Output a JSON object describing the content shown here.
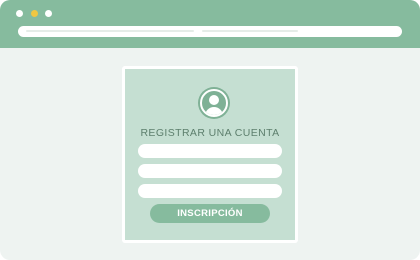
{
  "colors": {
    "titlebar": "#86bb9e",
    "window_background": "#eef3f1",
    "card_background": "#c5dfd2",
    "accent": "#86bb9e",
    "title_text": "#5d7f6d",
    "minimize_dot": "#f0c742"
  },
  "window": {
    "controls": [
      "close-dot",
      "minimize-dot",
      "maximize-dot"
    ]
  },
  "address_bar": {
    "value": ""
  },
  "form": {
    "avatar_icon": "user-avatar-icon",
    "title": "REGISTRAR UNA CUENTA",
    "fields": [
      {
        "value": ""
      },
      {
        "value": ""
      },
      {
        "value": ""
      }
    ],
    "submit_label": "INSCRIPCIÓN"
  }
}
